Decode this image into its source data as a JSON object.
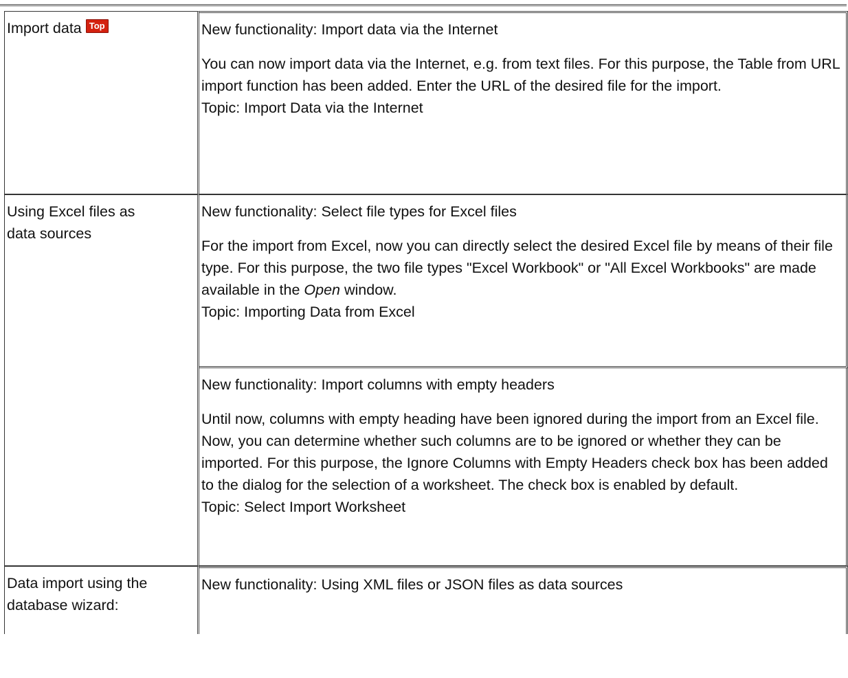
{
  "sections": [
    {
      "topic_area": "Import data",
      "badge": "Top",
      "items": [
        {
          "heading": "New functionality: Import data via the Internet",
          "body": "You can now import data via the Internet, e.g. from text files. For this purpose, the Table from URL import function has been added. Enter the URL of the desired file for the import.",
          "topic": "Topic: Import Data via the Internet"
        }
      ]
    },
    {
      "topic_area_line1": "Using Excel files as",
      "topic_area_line2": "data sources",
      "items": [
        {
          "heading": "New functionality: Select file types for Excel files",
          "body_part1": "For the import from Excel, now you can directly select the desired Excel file by means of their file type. For this purpose, the two file types \"Excel Workbook\" or \"All Excel Workbooks\" are made available  in the ",
          "body_italic": "Open",
          "body_part2": " window.",
          "topic": "Topic: Importing Data from Excel"
        },
        {
          "heading": "New functionality: Import columns with empty headers",
          "body": "Until now, columns with empty heading have been ignored during the import from an Excel file. Now, you can determine whether such columns are to be ignored or whether they can be imported. For this purpose, the Ignore Columns with Empty Headers check box has been added to the dialog for the selection of a worksheet. The check box is enabled by default.",
          "topic": "Topic: Select Import Worksheet"
        }
      ]
    },
    {
      "topic_area_line1": "Data import using the",
      "topic_area_line2": "database wizard:",
      "items": [
        {
          "heading": "New functionality: Using XML files or JSON files as data sources"
        }
      ]
    }
  ]
}
